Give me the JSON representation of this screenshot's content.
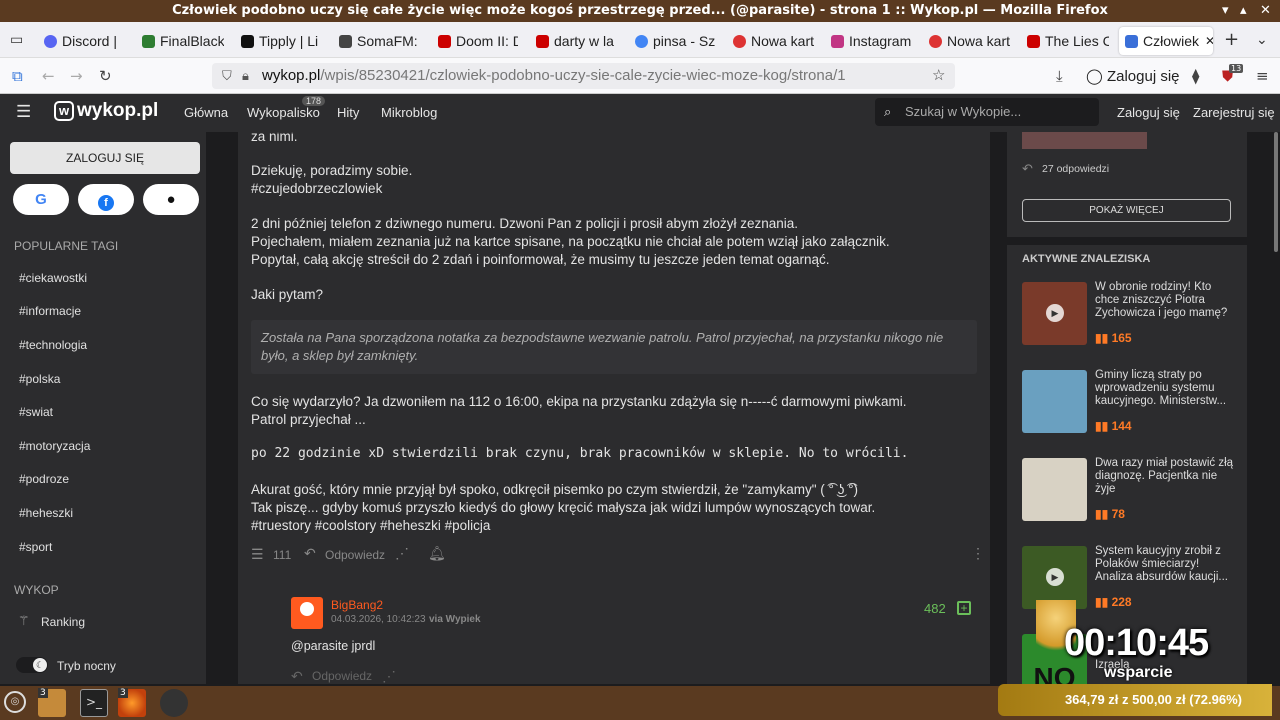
{
  "window": {
    "title": "Człowiek podobno uczy się całe życie więc może kogoś przestrzegę przed... (@parasite) - strona 1 :: Wykop.pl — Mozilla Firefox"
  },
  "tabs": [
    {
      "label": "Discord |",
      "color": "#5865f2"
    },
    {
      "label": "FinalBlack",
      "color": "#2e7d32"
    },
    {
      "label": "Tipply | Li",
      "color": "#111111"
    },
    {
      "label": "SomaFM:",
      "color": "#444444"
    },
    {
      "label": "Doom II: D",
      "color": "#cc0000"
    },
    {
      "label": "darty w la",
      "color": "#cc0000"
    },
    {
      "label": "pinsa - Sz",
      "color": "#4285f4"
    },
    {
      "label": "Nowa kart",
      "color": "#d33"
    },
    {
      "label": "Instagram",
      "color": "#c13584"
    },
    {
      "label": "Nowa kart",
      "color": "#d33"
    },
    {
      "label": "The Lies C",
      "color": "#cc0000"
    },
    {
      "label": "Człowiek",
      "color": "#3a6fd8"
    }
  ],
  "navbar": {
    "url_host": "wykop.pl",
    "url_path": "/wpis/85230421/czlowiek-podobno-uczy-sie-cale-zycie-wiec-moze-kog/strona/1",
    "login": "Zaloguj się",
    "ext_badge": "13"
  },
  "site_header": {
    "logo": "wykop.pl",
    "nav": [
      "Główna",
      "Wykopalisko",
      "Hity",
      "Mikroblog"
    ],
    "wykopalisko_count": "178",
    "search_placeholder": "Szukaj w Wykopie...",
    "login": "Zaloguj się",
    "register": "Zarejestruj się"
  },
  "left_sidebar": {
    "login_button": "ZALOGUJ SIĘ",
    "popular_tags_heading": "POPULARNE TAGI",
    "tags": [
      "#ciekawostki",
      "#informacje",
      "#technologia",
      "#polska",
      "#swiat",
      "#motoryzacja",
      "#podroze",
      "#heheszki",
      "#sport"
    ],
    "wykop_heading": "WYKOP",
    "ranking": "Ranking",
    "night_mode": "Tryb nocny"
  },
  "post": {
    "lines": {
      "l0": "za nimi.",
      "l1": "Dziekuję, poradzimy sobie.",
      "l2": "#czujedobrzeczlowiek",
      "l3": "2 dni później telefon z dziwnego numeru. Dzwoni Pan z policji i prosił abym złożył zeznania.",
      "l4": "Pojechałem, miałem zeznania już na kartce spisane, na początku nie chciał ale potem wziął jako załącznik.",
      "l5": "Popytał, całą akcję streścił do 2 zdań i poinformował, że musimy tu jeszcze jeden temat ogarnąć.",
      "l6": "Jaki pytam?",
      "quote": "Została na Pana sporządzona notatka za bezpodstawne wezwanie patrolu. Patrol przyjechał, na przystanku nikogo nie było, a sklep był zamknięty.",
      "l7": "Co się wydarzyło? Ja dzwoniłem na 112 o 16:00, ekipa na przystanku zdążyła się n-----ć darmowymi piwkami.",
      "l8": "Patrol przyjechał ...",
      "l9": "po 22 godzinie xD stwierdzili brak czynu, brak pracowników w sklepie. No to wrócili.",
      "l10": "Akurat gość, który mnie przyjął był spoko, odkręcił pisemko po czym stwierdził, że \"zamykamy\" ( ͡° ͜ʖ ͡°)",
      "l11": "Tak piszę... gdyby komuś przyszło kiedyś do głowy kręcić małysza jak widzi lumpów wynoszących towar.",
      "l12": "#truestory #coolstory #heheszki #policja"
    },
    "comments_count": "111",
    "reply": "Odpowiedz"
  },
  "comment": {
    "author": "BigBang2",
    "meta": "04.03.2026, 10:42:23",
    "via": "via Wypiek",
    "votes": "482",
    "text": "@parasite jprdl",
    "reply": "Odpowiedz"
  },
  "right_sidebar": {
    "replies": "27 odpowiedzi",
    "more_button": "POKAŻ WIĘCEJ",
    "active_heading": "AKTYWNE ZNALEZISKA",
    "findings": [
      {
        "title": "W obronie rodziny! Kto chce zniszczyć Piotra Zychowicza i jego mamę?",
        "score": "165",
        "thumb": "#7a3a2a"
      },
      {
        "title": "Gminy liczą straty po wprowadzeniu systemu kaucyjnego. Ministerstw...",
        "score": "144",
        "thumb": "#6aa0c0"
      },
      {
        "title": "Dwa razy miał postawić złą diagnozę. Pacjentka nie żyje",
        "score": "78",
        "thumb": "#d8d2c4"
      },
      {
        "title": "System kaucyjny zrobił z Polaków śmieciarzy! Analiza absurdów kaucji...",
        "score": "228",
        "thumb": "#3c5a24"
      },
      {
        "title": "Izraela",
        "score": "",
        "thumb": "#2c8a2c"
      }
    ]
  },
  "overlay": {
    "timer": "00:10:45",
    "label": "wsparcie",
    "progress": "364,79 zł z 500,00 zł (72.96%)"
  },
  "taskbar": {
    "badge1": "3",
    "badge2": "3"
  }
}
